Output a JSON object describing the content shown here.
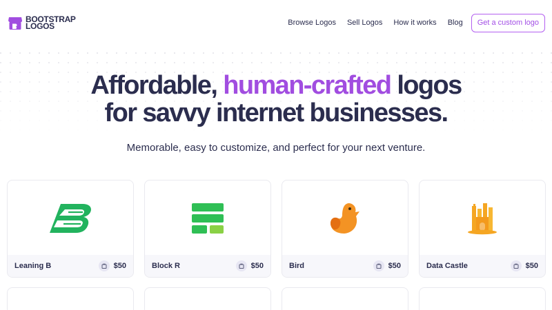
{
  "brand": {
    "line1": "BOOTSTRAP",
    "line2": "LOGOS",
    "color": "#a14de0"
  },
  "nav": {
    "items": [
      "Browse Logos",
      "Sell Logos",
      "How it works",
      "Blog"
    ],
    "cta": "Get a custom logo"
  },
  "hero": {
    "line1_pre": "Affordable, ",
    "line1_accent": "human-crafted",
    "line1_post": " logos",
    "line2": "for savvy internet businesses.",
    "subtitle": "Memorable, easy to customize, and perfect for your next venture."
  },
  "logos": [
    {
      "name": "Leaning B",
      "price": "$50",
      "icon": "leaning-b-logo",
      "color": "#22b35e"
    },
    {
      "name": "Block R",
      "price": "$50",
      "icon": "block-r-logo",
      "color": "#2fbf55"
    },
    {
      "name": "Bird",
      "price": "$50",
      "icon": "bird-logo",
      "color": "#f08a1c"
    },
    {
      "name": "Data Castle",
      "price": "$50",
      "icon": "data-castle-logo",
      "color": "#f5a623"
    }
  ]
}
